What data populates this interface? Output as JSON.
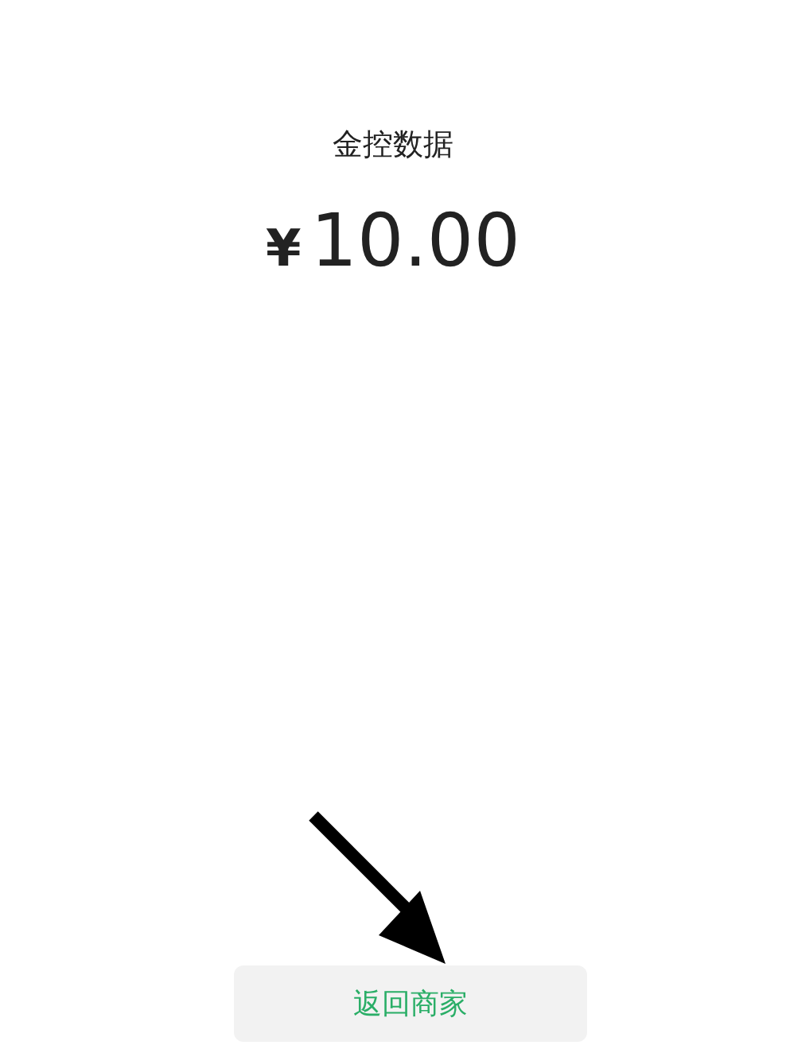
{
  "payee": "金控数据",
  "amount": {
    "currency": "¥",
    "value": "10.00"
  },
  "buttons": [
    {
      "label": "返回商家"
    }
  ]
}
